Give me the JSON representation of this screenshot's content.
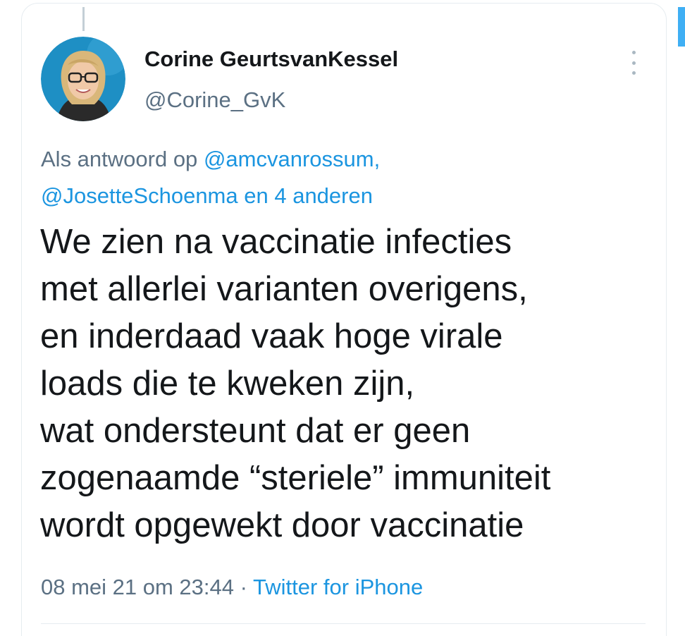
{
  "author": {
    "display_name": "Corine GeurtsvanKessel",
    "handle": "@Corine_GvK"
  },
  "reply_to": {
    "prefix": "Als antwoord op",
    "mention_1": "@amcvanrossum,",
    "mention_2": "@JosetteSchoenma",
    "suffix": "en 4 anderen"
  },
  "tweet": {
    "lines": [
      "We zien na vaccinatie infecties",
      "met allerlei varianten overigens,",
      "en inderdaad vaak hoge virale",
      "loads die te kweken zijn,",
      "wat ondersteunt dat er geen",
      "zogenaamde “steriele” immuniteit",
      "wordt opgewekt door vaccinatie"
    ]
  },
  "meta": {
    "timestamp": "08 mei 21 om 23:44",
    "separator": " · ",
    "source": "Twitter for iPhone"
  },
  "icons": {
    "more": "more-vertical-icon",
    "avatar": "profile-photo"
  },
  "colors": {
    "link": "#1b95e0",
    "secondary_text": "#5b7083",
    "primary_text": "#14171a"
  }
}
